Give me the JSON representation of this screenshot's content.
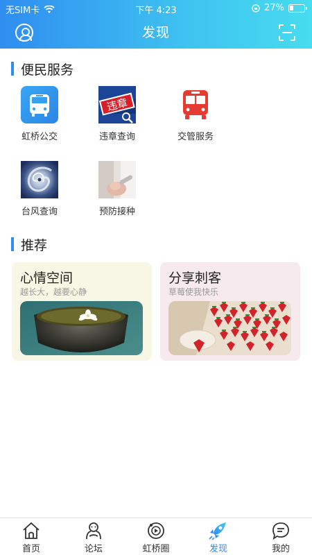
{
  "status_bar": {
    "carrier": "无SIM卡",
    "time": "下午 4:23",
    "battery": "27%",
    "battery_level": 0.27
  },
  "nav": {
    "title": "发现"
  },
  "sections": {
    "services_title": "便民服务",
    "recommend_title": "推荐"
  },
  "services": [
    {
      "label": "虹桥公交",
      "icon": "bus-icon"
    },
    {
      "label": "违章查询",
      "icon": "violation-icon",
      "badge": "违章"
    },
    {
      "label": "交管服务",
      "icon": "traffic-bus-icon"
    },
    {
      "label": "台风查询",
      "icon": "typhoon-icon"
    },
    {
      "label": "预防接种",
      "icon": "vaccination-icon"
    }
  ],
  "cards": [
    {
      "title": "心情空间",
      "subtitle": "越长大，越要心静",
      "bg": "#f8f7e6"
    },
    {
      "title": "分享刺客",
      "subtitle": "草莓使我快乐",
      "bg": "#f6eaef"
    }
  ],
  "tabs": [
    {
      "label": "首页",
      "icon": "home-icon"
    },
    {
      "label": "论坛",
      "icon": "forum-icon"
    },
    {
      "label": "虹桥圈",
      "icon": "circle-icon"
    },
    {
      "label": "发现",
      "icon": "rocket-icon",
      "active": true
    },
    {
      "label": "我的",
      "icon": "chat-icon"
    }
  ],
  "colors": {
    "accent": "#2f8df0",
    "header_end": "#47dcef"
  }
}
